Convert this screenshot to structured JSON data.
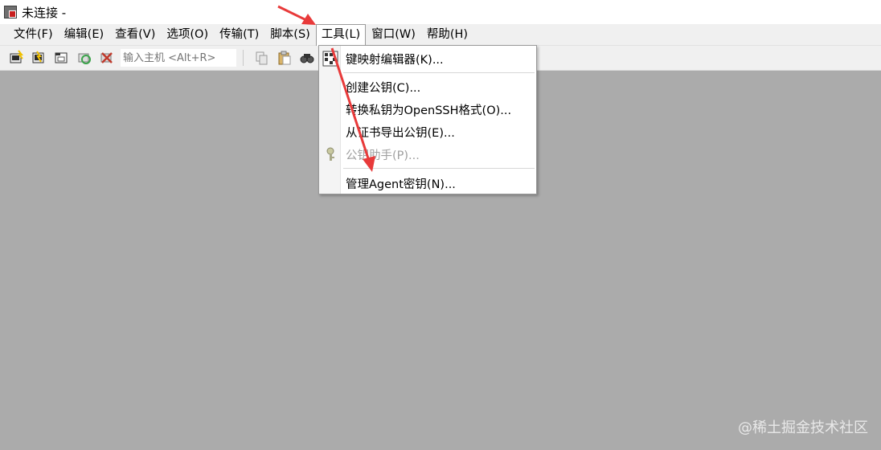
{
  "window": {
    "title": "未连接 -"
  },
  "menubar": {
    "items": [
      {
        "label": "文件(F)"
      },
      {
        "label": "编辑(E)"
      },
      {
        "label": "查看(V)"
      },
      {
        "label": "选项(O)"
      },
      {
        "label": "传输(T)"
      },
      {
        "label": "脚本(S)"
      },
      {
        "label": "工具(L)"
      },
      {
        "label": "窗口(W)"
      },
      {
        "label": "帮助(H)"
      }
    ],
    "active_item": "工具(L)"
  },
  "toolbar": {
    "buttons": [
      "connect-icon",
      "quick-connect-icon",
      "connect-tab-icon",
      "reconnect-icon",
      "disconnect-icon"
    ],
    "host_input_placeholder": "输入主机 <Alt+R>",
    "right_buttons": [
      "copy-icon",
      "paste-icon",
      "find-icon"
    ]
  },
  "tools_menu": {
    "items": [
      {
        "label": "键映射编辑器(K)...",
        "icon": "keymap-icon",
        "disabled": false
      },
      {
        "label": "创建公钥(C)...",
        "disabled": false
      },
      {
        "label": "转换私钥为OpenSSH格式(O)...",
        "disabled": false
      },
      {
        "label": "从证书导出公钥(E)...",
        "disabled": false
      },
      {
        "label": "公钥助手(P)...",
        "icon": "key-icon",
        "disabled": true
      },
      {
        "label": "管理Agent密钥(N)...",
        "disabled": false
      }
    ]
  },
  "annotations": {
    "arrow_color": "#e83a3a"
  },
  "watermark": "@稀土掘金技术社区"
}
